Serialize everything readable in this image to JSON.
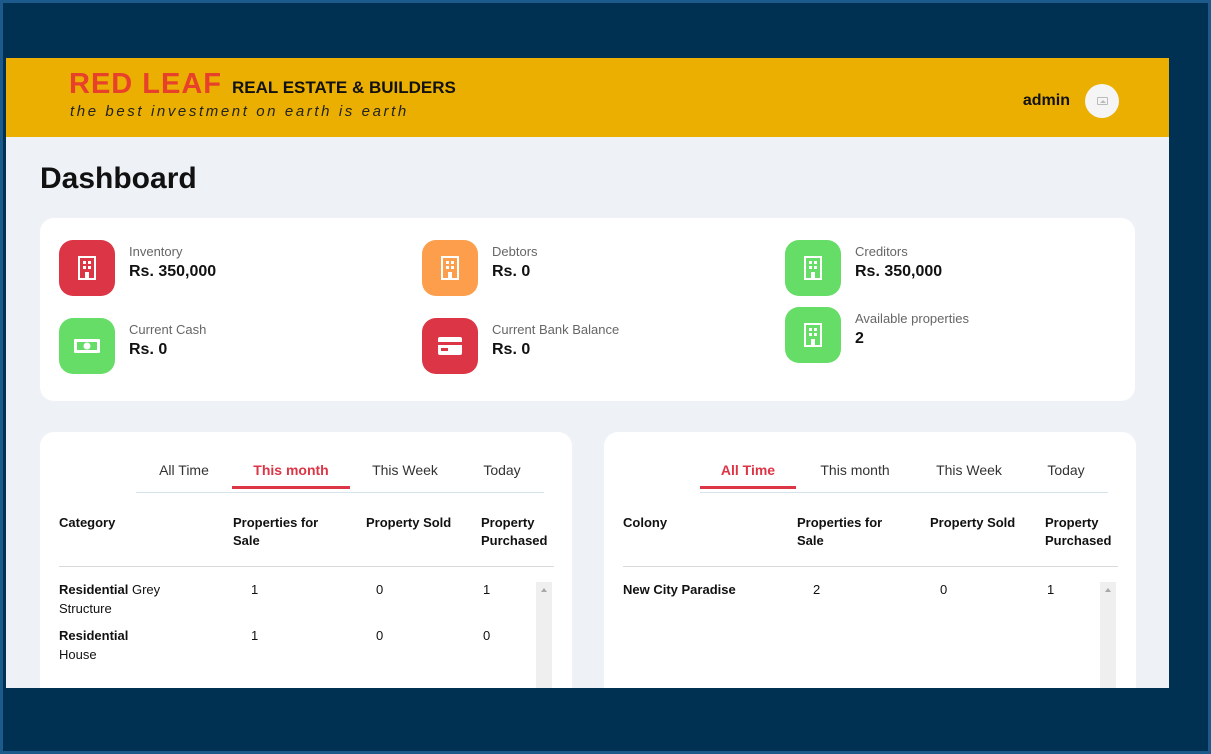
{
  "header": {
    "brand_primary": "RED LEAF",
    "brand_secondary": "REAL ESTATE & BUILDERS",
    "tagline": "the best investment on earth is earth",
    "user_name": "admin"
  },
  "page_title": "Dashboard",
  "stats": [
    {
      "label": "Inventory",
      "value": "Rs. 350,000",
      "icon": "building-icon",
      "color": "#dc3545"
    },
    {
      "label": "Debtors",
      "value": "Rs. 0",
      "icon": "building-icon",
      "color": "#fd9e4c"
    },
    {
      "label": "Creditors",
      "value": "Rs. 350,000",
      "icon": "building-icon",
      "color": "#66dd66"
    },
    {
      "label": "Current Cash",
      "value": "Rs. 0",
      "icon": "cash-icon",
      "color": "#66dd66"
    },
    {
      "label": "Current Bank Balance",
      "value": "Rs. 0",
      "icon": "credit-card-icon",
      "color": "#dc3545"
    },
    {
      "label": "Available properties",
      "value": "2",
      "icon": "building-icon",
      "color": "#66dd66"
    }
  ],
  "category_table": {
    "tabs": [
      "All Time",
      "This month",
      "This Week",
      "Today"
    ],
    "active_tab": "This month",
    "headers": [
      "Category",
      "Properties for Sale",
      "Property Sold",
      "Property Purchased"
    ],
    "rows": [
      {
        "bold": "Residential",
        "rest": "Grey Structure",
        "sale": "1",
        "sold": "0",
        "purchased": "1"
      },
      {
        "bold": "Residential",
        "rest": "House",
        "sale": "1",
        "sold": "0",
        "purchased": "0"
      }
    ]
  },
  "colony_table": {
    "tabs": [
      "All Time",
      "This month",
      "This Week",
      "Today"
    ],
    "active_tab": "All Time",
    "headers": [
      "Colony",
      "Properties for Sale",
      "Property Sold",
      "Property Purchased"
    ],
    "rows": [
      {
        "bold": "New City Paradise",
        "rest": "",
        "sale": "2",
        "sold": "0",
        "purchased": "1"
      }
    ]
  },
  "colors": {
    "page_bg": "#003152",
    "topbar": "#eaaf00",
    "brand_red": "#e8412b",
    "accent_red": "#dc3545",
    "orange": "#fd9e4c",
    "green": "#66dd66"
  }
}
